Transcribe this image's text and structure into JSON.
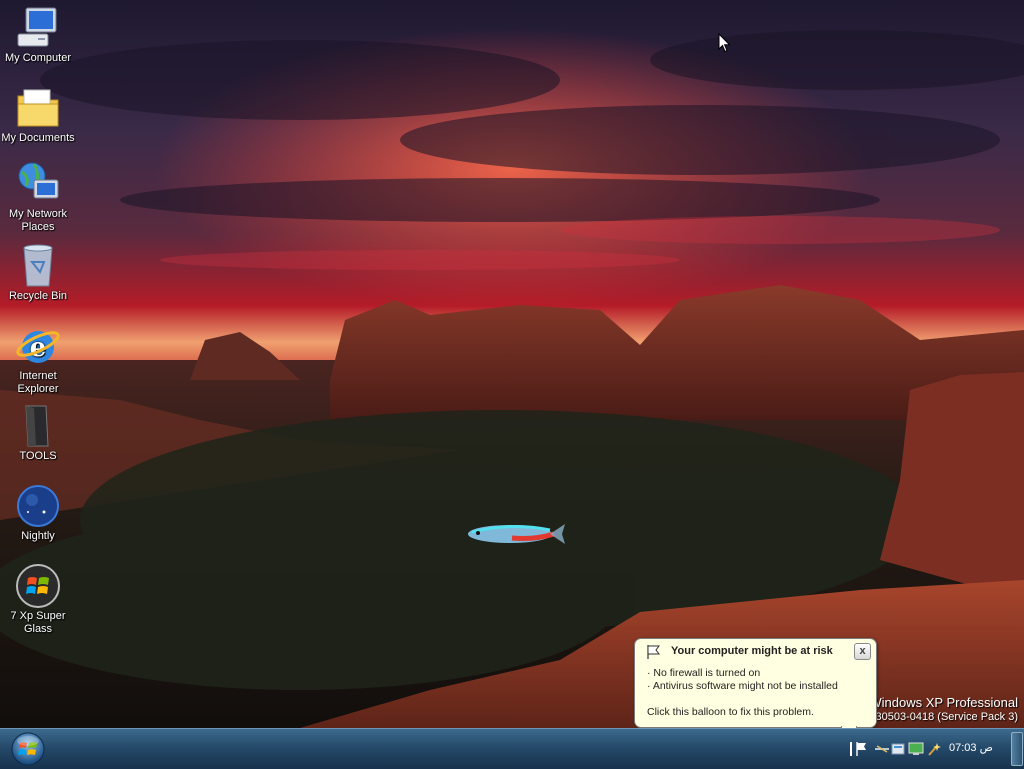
{
  "desktop": {
    "icons": [
      {
        "label": "My Computer",
        "icon": "my-computer-icon"
      },
      {
        "label": "My Documents",
        "icon": "my-documents-folder-icon"
      },
      {
        "label": "My Network Places",
        "icon": "network-places-icon"
      },
      {
        "label": "Recycle Bin",
        "icon": "recycle-bin-icon"
      },
      {
        "label": "Internet Explorer",
        "icon": "internet-explorer-icon"
      },
      {
        "label": "TOOLS",
        "icon": "tools-folder-icon"
      },
      {
        "label": "Nightly",
        "icon": "nightly-browser-icon"
      },
      {
        "label": "7 Xp Super Glass",
        "icon": "windows-logo-icon"
      }
    ]
  },
  "watermark": {
    "line1": "Windows XP Professional",
    "line2": "130503-0418 (Service Pack 3)"
  },
  "balloon": {
    "title": "Your computer might be at risk",
    "line1": "· No firewall is turned on",
    "line2": "· Antivirus software might not be installed",
    "footer": "Click this balloon to fix this problem.",
    "close_label": "x"
  },
  "taskbar": {
    "start_icon": "windows-orb-icon",
    "clock": "07:03 ص",
    "tray_icons": [
      "security-flag-icon",
      "network-icon",
      "folder-tray-icon",
      "monitor-tray-icon",
      "wand-tray-icon"
    ]
  },
  "colors": {
    "taskbar": "#254a6a",
    "balloon_bg": "#ffffe1",
    "sky_red": "#c8202a",
    "rock": "#7a2c22"
  }
}
